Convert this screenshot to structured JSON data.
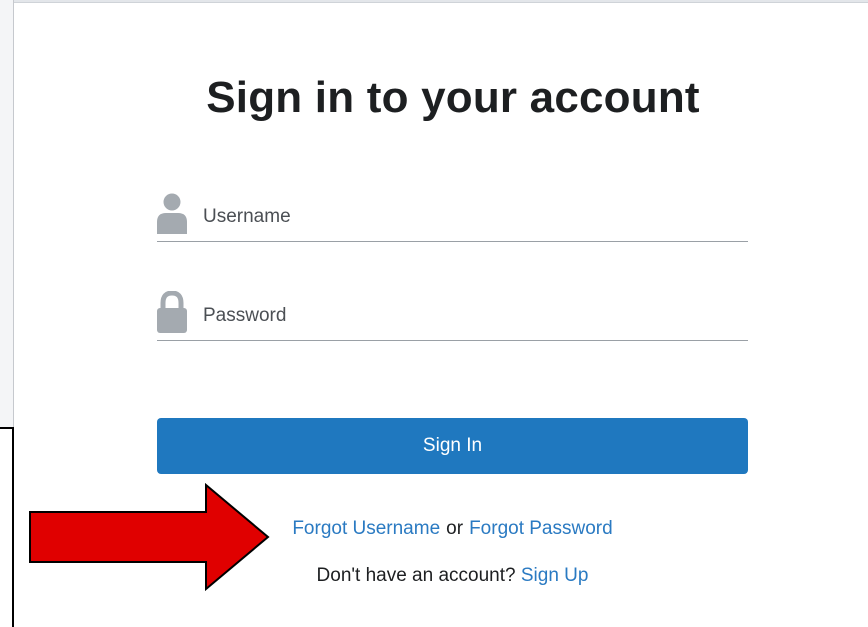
{
  "title": "Sign in to your account",
  "username": {
    "placeholder": "Username",
    "icon": "user-icon"
  },
  "password": {
    "placeholder": "Password",
    "icon": "lock-icon"
  },
  "signin_button": "Sign In",
  "forgot_username": "Forgot Username",
  "or_text": "or",
  "forgot_password": "Forgot Password",
  "no_account_text": "Don't have an account?",
  "sign_up": "Sign Up",
  "annotation": {
    "icon": "red-arrow-icon",
    "color": "#e00000"
  },
  "colors": {
    "primary": "#1f78bf",
    "link": "#2a7ac2",
    "icon_gray": "#a4aab0"
  }
}
